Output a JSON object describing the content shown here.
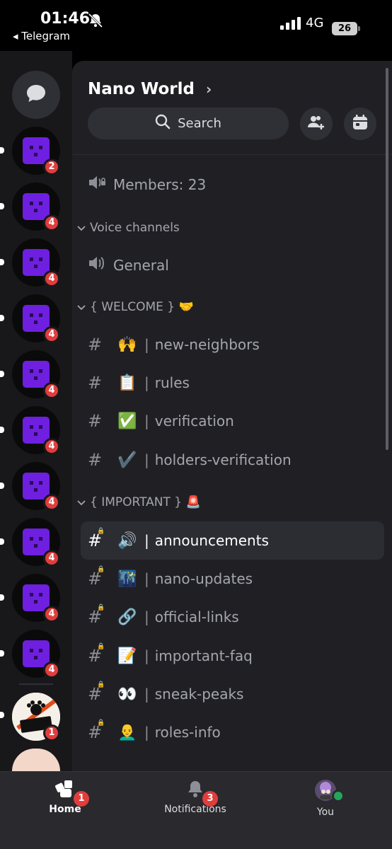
{
  "status": {
    "time": "01:46",
    "back_app": "◂ Telegram",
    "network": "4G",
    "battery": "26"
  },
  "rail": {
    "dm_icon": "chat-bubble-icon",
    "servers": [
      {
        "badge": "2"
      },
      {
        "badge": "4"
      },
      {
        "badge": "4"
      },
      {
        "badge": "4"
      },
      {
        "badge": "4"
      },
      {
        "badge": "4"
      },
      {
        "badge": "4"
      },
      {
        "badge": "4"
      },
      {
        "badge": "4"
      },
      {
        "badge": "4"
      }
    ],
    "badbears": {
      "badge": "1"
    }
  },
  "server": {
    "name": "Nano World",
    "chevron": "›"
  },
  "search": {
    "label": "Search"
  },
  "members": {
    "label": "Members: 23"
  },
  "voice_category": {
    "label": "Voice channels"
  },
  "voice_channels": [
    {
      "name": "General"
    }
  ],
  "welcome_category": {
    "label": "{ WELCOME } 🤝"
  },
  "welcome_channels": [
    {
      "emoji": "🙌",
      "name": "new-neighbors"
    },
    {
      "emoji": "📋",
      "name": "rules"
    },
    {
      "emoji": "✅",
      "name": "verification"
    },
    {
      "emoji": "✔️",
      "name": "holders-verification"
    }
  ],
  "important_category": {
    "label": "{ IMPORTANT } 🚨"
  },
  "important_channels": [
    {
      "emoji": "🔊",
      "name": "announcements",
      "selected": true
    },
    {
      "emoji": "🌃",
      "name": "nano-updates"
    },
    {
      "emoji": "🔗",
      "name": "official-links"
    },
    {
      "emoji": "📝",
      "name": "important-faq"
    },
    {
      "emoji": "👀",
      "name": "sneak-peaks"
    },
    {
      "emoji": "👨‍🦲",
      "name": "roles-info"
    }
  ],
  "tabs": [
    {
      "label": "Home",
      "badge": "1"
    },
    {
      "label": "Notifications",
      "badge": "3"
    },
    {
      "label": "You"
    }
  ],
  "colors": {
    "accent_badge": "#e13d3d",
    "server_purple": "#6e1fe0",
    "panel": "#202024",
    "rail": "#18181b"
  }
}
